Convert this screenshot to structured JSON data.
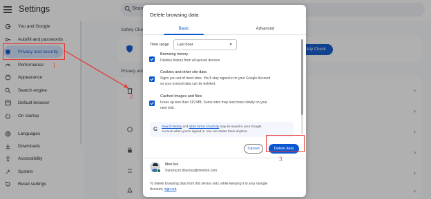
{
  "app": {
    "title": "Settings"
  },
  "search": {
    "placeholder": "Search settings"
  },
  "sidebar": {
    "items": [
      {
        "label": "You and Google",
        "icon": "google-icon"
      },
      {
        "label": "Autofill and passwords",
        "icon": "key-icon"
      },
      {
        "label": "Privacy and security",
        "icon": "shield-icon"
      },
      {
        "label": "Performance",
        "icon": "speedometer-icon"
      },
      {
        "label": "Appearance",
        "icon": "palette-icon"
      },
      {
        "label": "Search engine",
        "icon": "search-icon"
      },
      {
        "label": "Default browser",
        "icon": "browser-icon"
      },
      {
        "label": "On startup",
        "icon": "power-icon"
      },
      {
        "label": "Languages",
        "icon": "language-icon"
      },
      {
        "label": "Downloads",
        "icon": "download-icon"
      },
      {
        "label": "Accessibility",
        "icon": "accessibility-icon"
      },
      {
        "label": "System",
        "icon": "wrench-icon"
      },
      {
        "label": "Reset settings",
        "icon": "reset-icon"
      }
    ]
  },
  "content": {
    "safety_label": "Safety Che",
    "safety_button": "afety Check",
    "privacy_label": "Privacy and"
  },
  "dialog": {
    "title": "Delete browsing data",
    "tabs": {
      "basic": "Basic",
      "advanced": "Advanced"
    },
    "time_range": {
      "label": "Time range",
      "value": "Last hour"
    },
    "options": [
      {
        "title": "Browsing history",
        "desc": "Deletes history from all synced devices",
        "checked": true
      },
      {
        "title": "Cookies and other site data",
        "desc_line1": "Signs you out of most sites. You'll stay signed in to your Google Account",
        "desc_line2": "so your synced data can be deleted.",
        "checked": true
      },
      {
        "title": "Cached images and files",
        "desc_line1": "Frees up less than 319 MB. Some sites may load more slowly on your",
        "desc_line2": "next visit.",
        "checked": true
      }
    ],
    "google_note": {
      "link1": "Search history",
      "and": " and ",
      "link2": "other forms of activity",
      "rest1": " may be saved in your Google",
      "rest2": "Account when you're signed in. You can delete them anytime."
    },
    "buttons": {
      "cancel": "Cancel",
      "delete": "Delete data"
    },
    "account": {
      "name": "libur luo",
      "sync": "Syncing to libur.luo@minitool.com"
    },
    "footer": {
      "line1": "To delete browsing data from this device only, while keeping it in your Google",
      "line2_prefix": "Account, ",
      "link": "sign out",
      "line2_suffix": "."
    }
  },
  "annotations": {
    "step1": "1",
    "step2": "2",
    "step3": "3"
  },
  "colors": {
    "accent": "#0b57d0",
    "annotation": "#e53935",
    "active_nav_bg": "#d3e3fd"
  }
}
